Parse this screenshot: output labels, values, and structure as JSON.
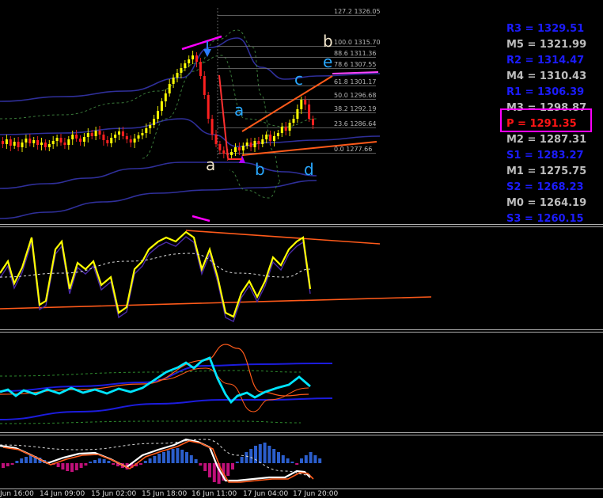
{
  "colors": {
    "background": "#000000",
    "pivot_blue": "#1c1cff",
    "pivot_gray": "#bdbdbd",
    "pivot_red": "#ff1515",
    "highlight": "#ff00ff",
    "fib": "#8a8a8a",
    "trend": "#ff5a1a",
    "rsi": "#ffff00",
    "osc": "#00e5ff",
    "bull": "#ffff00",
    "bear": "#ff2020"
  },
  "pivots": [
    {
      "label": "R3 = 1329.51",
      "color": "blue"
    },
    {
      "label": "M5 = 1321.99",
      "color": "gray"
    },
    {
      "label": "R2 = 1314.47",
      "color": "blue"
    },
    {
      "label": "M4 = 1310.43",
      "color": "gray"
    },
    {
      "label": "R1 = 1306.39",
      "color": "blue"
    },
    {
      "label": "M3 = 1298.87",
      "color": "gray"
    },
    {
      "label": "P  = 1291.35",
      "color": "red"
    },
    {
      "label": "M2 = 1287.31",
      "color": "gray"
    },
    {
      "label": "S1 = 1283.27",
      "color": "blue"
    },
    {
      "label": "M1 = 1275.75",
      "color": "gray"
    },
    {
      "label": "S2 = 1268.23",
      "color": "blue"
    },
    {
      "label": "M0 = 1264.19",
      "color": "gray"
    },
    {
      "label": "S3 = 1260.15",
      "color": "blue"
    }
  ],
  "fib_levels": [
    "127.2 1326.05",
    "100.0 1315.70",
    "88.6 1311.36",
    "78.6 1307.55",
    "61.8 1301.17",
    "50.0 1296.68",
    "38.2 1292.19",
    "23.6 1286.64",
    "0.0 1277.66"
  ],
  "wave_labels": {
    "a_low": "a",
    "b_up": "b",
    "e_up": "e",
    "c_up": "c",
    "a_mid": "a",
    "b_low": "b",
    "d_low": "d"
  },
  "x_labels": [
    "Jun 16:00",
    "14 Jun 09:00",
    "15 Jun 02:00",
    "15 Jun 18:00",
    "16 Jun 11:00",
    "17 Jun 04:00",
    "17 Jun 20:00"
  ]
}
